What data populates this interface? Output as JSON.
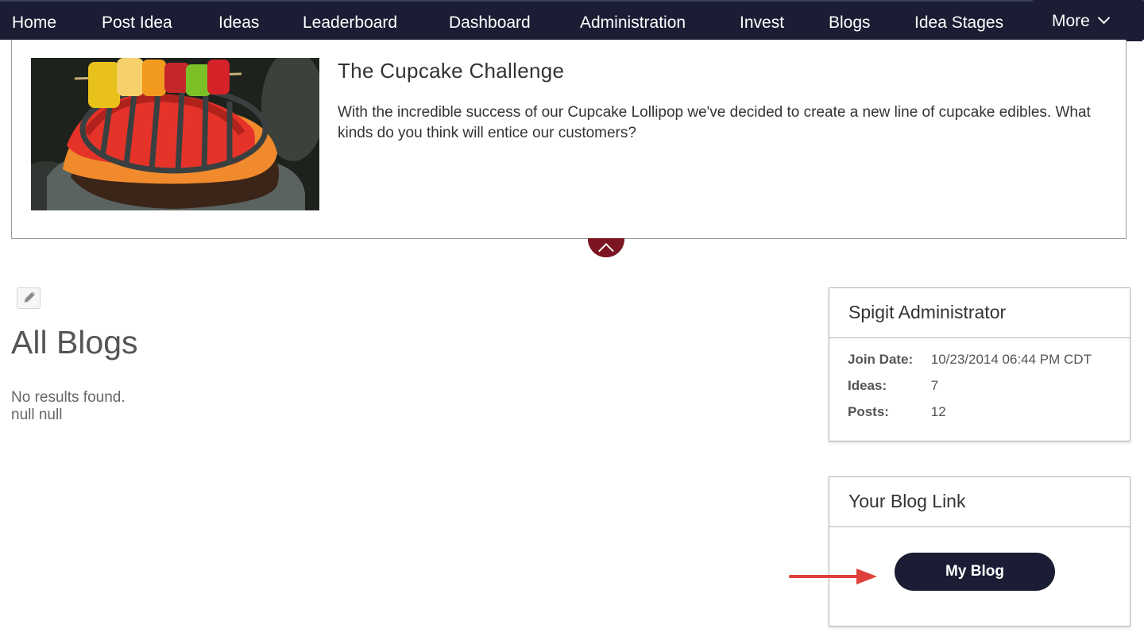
{
  "nav": {
    "items": [
      "Home",
      "Post Idea",
      "Ideas",
      "Leaderboard",
      "Dashboard",
      "Administration",
      "Invest",
      "Blogs",
      "Idea Stages"
    ],
    "more_label": "More"
  },
  "banner": {
    "title": "The Cupcake Challenge",
    "description": "With the incredible success of our Cupcake Lollipop we've decided to create a new line of cupcake edibles. What kinds do you think will entice our customers?",
    "image_alt": "Cupcake decorated with a grill and gummy kebab"
  },
  "main": {
    "title": "All Blogs",
    "no_results": "No results found.",
    "null_text": "null null"
  },
  "profile": {
    "name": "Spigit Administrator",
    "stats": [
      {
        "label": "Join Date:",
        "value": "10/23/2014 06:44 PM CDT"
      },
      {
        "label": "Ideas:",
        "value": "7"
      },
      {
        "label": "Posts:",
        "value": "12"
      }
    ]
  },
  "blog_link": {
    "title": "Your Blog Link",
    "button_label": "My Blog"
  },
  "colors": {
    "nav_bg": "#1a1d33",
    "accent": "#7a1521",
    "annotation_arrow": "#e0403a"
  }
}
